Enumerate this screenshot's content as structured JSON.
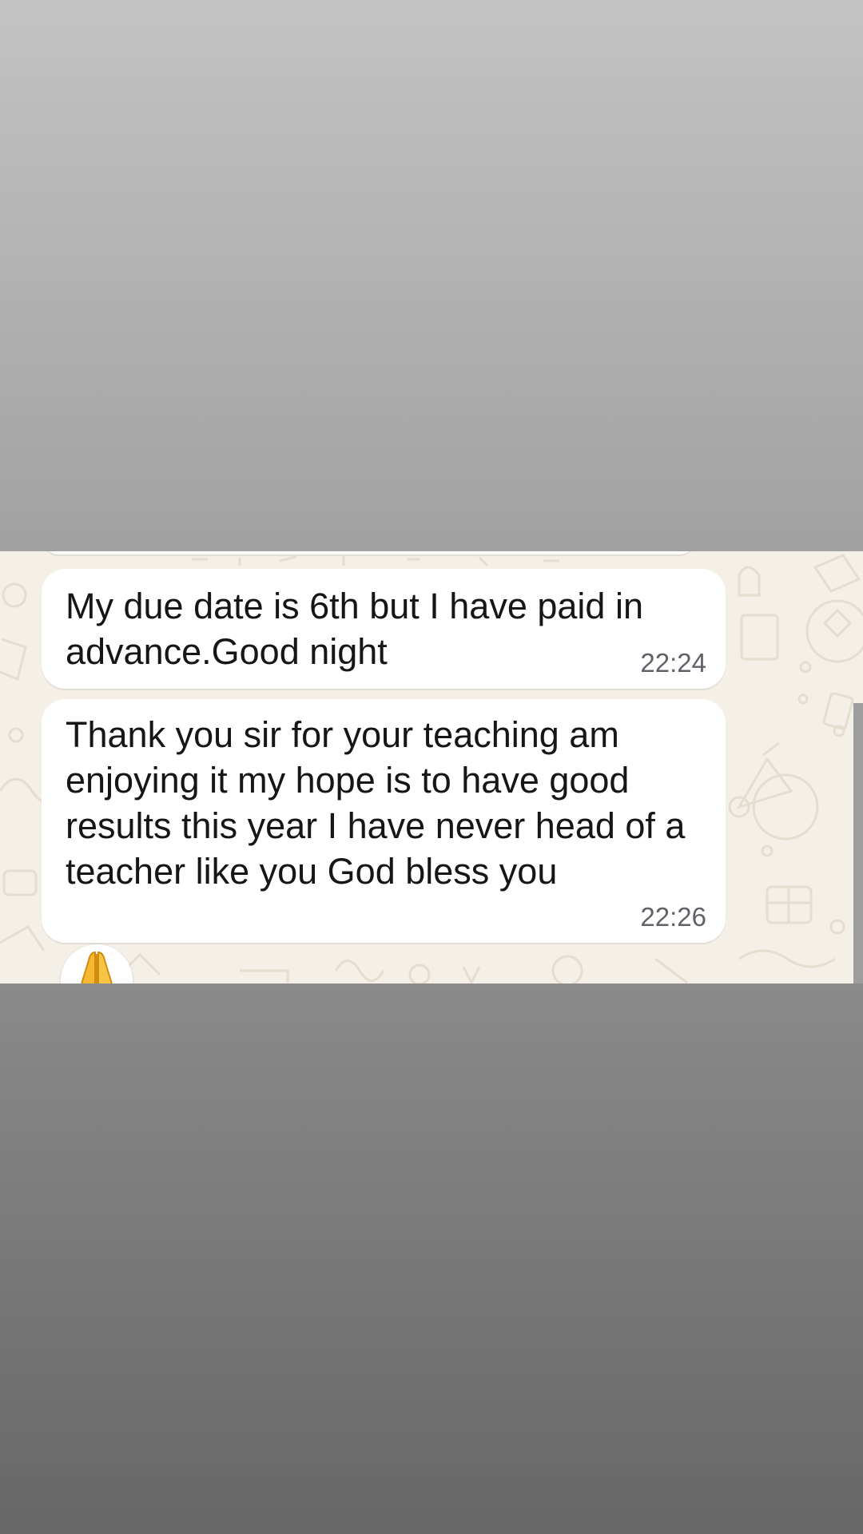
{
  "messages": [
    {
      "text": "My due date is 6th but I have paid in advance.Good night",
      "time": "22:24"
    },
    {
      "text": "Thank you sir for your teaching am enjoying it my hope is to have good results this year I have never head of a teacher like you God bless you",
      "time": "22:26"
    }
  ],
  "reaction": {
    "icon": "folded-hands-icon"
  },
  "colors": {
    "chat_background": "#f4f0e8",
    "bubble": "#ffffff",
    "message_text": "#161616",
    "timestamp": "#5f6368",
    "top_background": "#c3c3c3",
    "bottom_background": "#676767"
  }
}
